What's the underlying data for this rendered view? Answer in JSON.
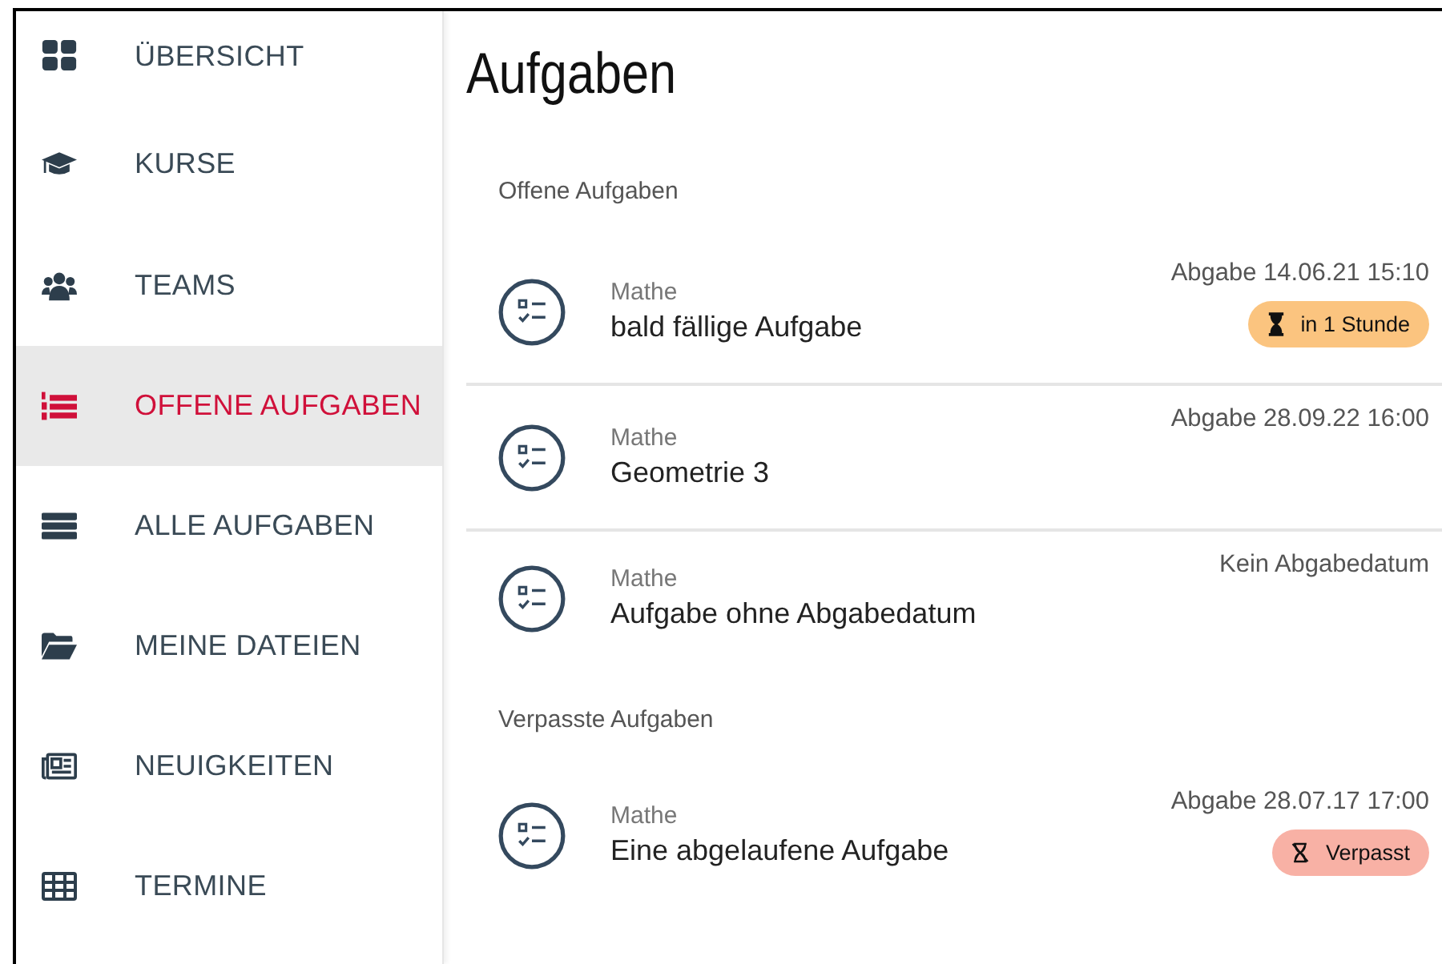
{
  "sidebar": {
    "items": [
      {
        "label": "ÜBERSICHT",
        "selected": false
      },
      {
        "label": "KURSE",
        "selected": false
      },
      {
        "label": "TEAMS",
        "selected": false
      },
      {
        "label": "OFFENE AUFGABEN",
        "selected": true
      },
      {
        "label": "ALLE AUFGABEN",
        "selected": false
      },
      {
        "label": "MEINE DATEIEN",
        "selected": false
      },
      {
        "label": "NEUIGKEITEN",
        "selected": false
      },
      {
        "label": "TERMINE",
        "selected": false
      }
    ]
  },
  "title": "Aufgaben",
  "sections": [
    {
      "heading": "Offene Aufgaben",
      "tasks": [
        {
          "course": "Mathe",
          "name": "bald fällige Aufgabe",
          "due": "Abgabe 14.06.21 15:10",
          "badge": {
            "kind": "soon",
            "text": "in 1 Stunde",
            "color": "#fbc47f"
          }
        },
        {
          "course": "Mathe",
          "name": "Geometrie 3",
          "due": "Abgabe 28.09.22 16:00"
        },
        {
          "course": "Mathe",
          "name": "Aufgabe ohne Abgabedatum",
          "due": "Kein Abgabedatum"
        }
      ]
    },
    {
      "heading": "Verpasste Aufgaben",
      "tasks": [
        {
          "course": "Mathe",
          "name": "Eine abgelaufene Aufgabe",
          "due": "Abgabe 28.07.17 17:00",
          "badge": {
            "kind": "missed",
            "text": "Verpasst",
            "color": "#f8b1a5"
          }
        }
      ]
    }
  ]
}
